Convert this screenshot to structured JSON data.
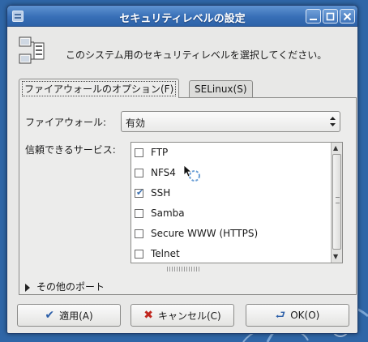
{
  "window": {
    "title": "セキュリティレベルの設定",
    "controls": [
      "minimize",
      "maximize",
      "close"
    ]
  },
  "header": {
    "description": "このシステム用のセキュリティレベルを選択してください。",
    "icon": "network-security-icon"
  },
  "tabs": [
    {
      "label": "ファイアウォールのオプション(F)",
      "active": true
    },
    {
      "label": "SELinux(S)",
      "active": false
    }
  ],
  "firewall": {
    "label": "ファイアウォール:",
    "selected": "有効"
  },
  "services": {
    "label": "信頼できるサービス:",
    "items": [
      {
        "name": "FTP",
        "checked": false
      },
      {
        "name": "NFS4",
        "checked": false
      },
      {
        "name": "SSH",
        "checked": true
      },
      {
        "name": "Samba",
        "checked": false
      },
      {
        "name": "Secure WWW (HTTPS)",
        "checked": false
      },
      {
        "name": "Telnet",
        "checked": false
      }
    ]
  },
  "other_ports": {
    "label": "その他のポート"
  },
  "buttons": {
    "apply": "適用(A)",
    "cancel": "キャンセル(C)",
    "ok": "OK(O)"
  },
  "colors": {
    "titlebar": "#386fb7",
    "window_bg": "#e8e8e7",
    "check_accent": "#3a6fb0"
  }
}
